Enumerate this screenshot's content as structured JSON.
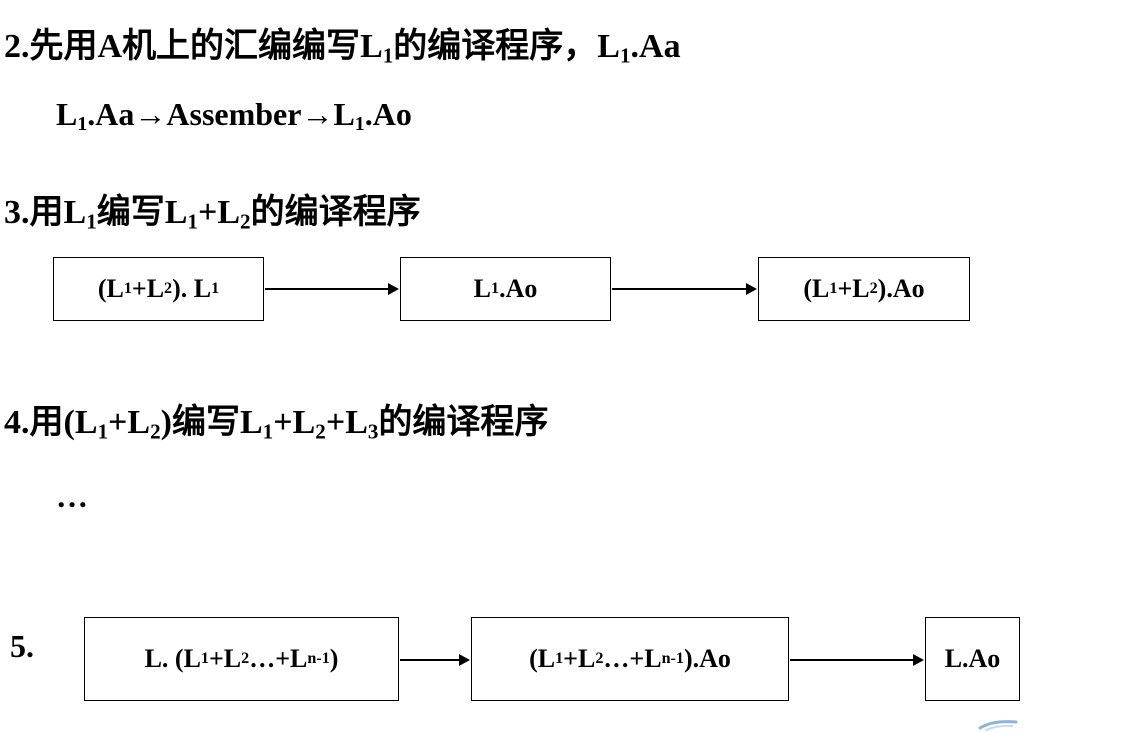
{
  "step2": {
    "num": "2.",
    "t1": "先用",
    "t2": "A",
    "t3": "机上的汇编编写",
    "t4": "L",
    "t4_sub": "1",
    "t5": "的编译程序，",
    "t6": "L",
    "t6_sub": "1",
    "t7": ".Aa"
  },
  "step2_chain": {
    "a": "L",
    "a_sub": "1",
    "b": ".Aa→Assember→L",
    "b_sub": "1",
    "c": ".Ao"
  },
  "step3": {
    "num": "3.",
    "t1": "用",
    "t2": "L",
    "t2_sub": "1",
    "t3": "编写",
    "t4": "L",
    "t4_sub": "1",
    "t5": "+L",
    "t5_sub": "2",
    "t6": "的编译程序",
    "box1": {
      "p1": "(L",
      "s1": "1",
      "p2": "+L",
      "s2": "2",
      "p3": "). L",
      "s3": "1"
    },
    "box2": {
      "p1": "L",
      "s1": "1",
      "p2": ".Ao"
    },
    "box3": {
      "p1": "(L",
      "s1": "1",
      "p2": "+L",
      "s2": "2",
      "p3": ").Ao"
    }
  },
  "step4": {
    "num": "4.",
    "t1": "用",
    "t2": "(L",
    "t2_sub": "1",
    "t3": "+L",
    "t3_sub": "2",
    "t4": ")",
    "t5": "编写",
    "t6": "L",
    "t6_sub": "1",
    "t7": "+L",
    "t7_sub": "2",
    "t8": "+L",
    "t8_sub": "3",
    "t9": "的编译程序",
    "ellipsis": "…"
  },
  "step5": {
    "num": "5.",
    "box1": {
      "p1": "L. (L",
      "s1": "1",
      "p2": "+L",
      "s2": "2",
      "p3": "…+L",
      "s3": "n-1",
      "p4": ")"
    },
    "box2": {
      "p1": "(L",
      "s1": "1",
      "p2": "+L",
      "s2": "2",
      "p3": "…+L",
      "s3": "n-1",
      "p4": ").Ao"
    },
    "box3": {
      "p1": "L.Ao"
    }
  }
}
